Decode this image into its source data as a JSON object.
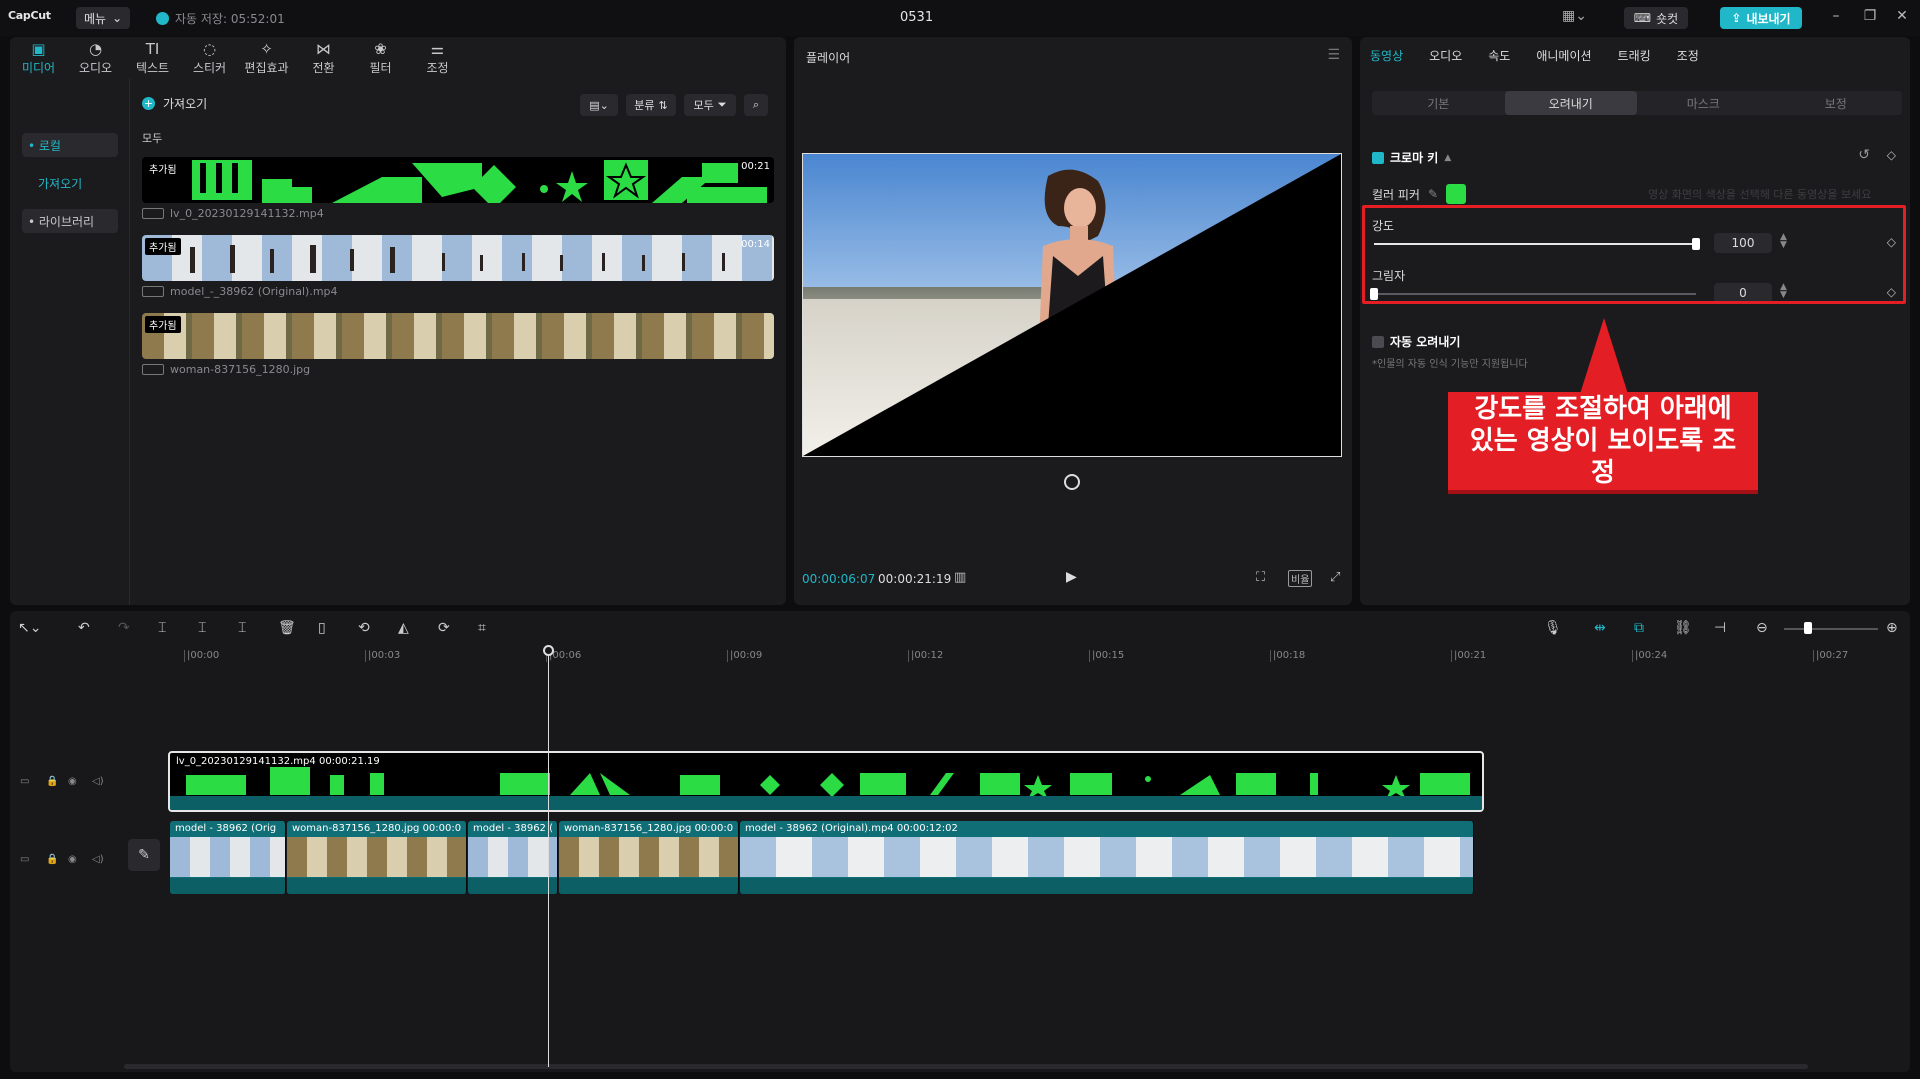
{
  "titlebar": {
    "logo": "CapCut",
    "menu_label": "메뉴",
    "autosave": "자동 저장: 05:52:01",
    "project_title": "0531",
    "shortcut_label": "숏컷",
    "export_label": "내보내기"
  },
  "media": {
    "tabs": [
      {
        "label": "미디어",
        "icon": "media-icon",
        "glyph": "▣"
      },
      {
        "label": "오디오",
        "icon": "audio-icon",
        "glyph": "◔"
      },
      {
        "label": "텍스트",
        "icon": "text-icon",
        "glyph": "TI"
      },
      {
        "label": "스티커",
        "icon": "sticker-icon",
        "glyph": "◌"
      },
      {
        "label": "편집효과",
        "icon": "effects-icon",
        "glyph": "✧"
      },
      {
        "label": "전환",
        "icon": "transition-icon",
        "glyph": "⋈"
      },
      {
        "label": "필터",
        "icon": "filter-icon",
        "glyph": "❀"
      },
      {
        "label": "조정",
        "icon": "adjust-icon",
        "glyph": "⚌"
      }
    ],
    "sidebar": {
      "local": "• 로컬",
      "import": "가져오기",
      "library": "• 라이브러리"
    },
    "import_button": "가져오기",
    "sort_label": "분류",
    "filter_label": "모두",
    "all_label": "모두",
    "clips": [
      {
        "badge": "추가됨",
        "duration": "00:21",
        "name": "lv_0_20230129141132.mp4"
      },
      {
        "badge": "추가됨",
        "duration": "00:14",
        "name": "model_-_38962 (Original).mp4"
      },
      {
        "badge": "추가됨",
        "duration": "",
        "name": "woman-837156_1280.jpg"
      }
    ]
  },
  "player": {
    "title": "플레이어",
    "current_time": "00:00:06:07",
    "total_time": "00:00:21:19",
    "ratio_label": "비율"
  },
  "properties": {
    "tabs": [
      "동영상",
      "오디오",
      "속도",
      "애니메이션",
      "트래킹",
      "조정"
    ],
    "active_tab": "동영상",
    "subtabs": [
      "기본",
      "오려내기",
      "마스크",
      "보정"
    ],
    "active_subtab": "오려내기",
    "chroma_key_label": "크로마 키",
    "color_picker_label": "컬러 피커",
    "picker_color": "#2bdc45",
    "faded_note": "영상 화면의 색상을 선택해 다른 동영상을 보세요",
    "intensity_label": "강도",
    "intensity_value": "100",
    "intensity_level": 100,
    "shadow_label": "그림자",
    "shadow_value": "0",
    "shadow_level": 0,
    "auto_cutout_label": "자동 오려내기",
    "auto_cutout_note": "*인물의 자동 인식 기능만 지원됩니다"
  },
  "callout": {
    "text": "강도를 조절하여 아래에 있는 영상이 보이도록 조정",
    "color": "#e31e24"
  },
  "timeline": {
    "ruler": [
      "|00:00",
      "|00:03",
      "|00:06",
      "|00:09",
      "|00:12",
      "|00:15",
      "|00:18",
      "|00:21",
      "|00:24",
      "|00:27"
    ],
    "main_clip": {
      "name": "lv_0_20230129141132.mp4",
      "duration": "00:00:21.19"
    },
    "sub_clips": [
      "model - 38962 (Orig",
      "woman-837156_1280.jpg  00:00:0",
      "model - 38962 (",
      "woman-837156_1280.jpg  00:00:0",
      "model - 38962 (Original).mp4   00:00:12:02"
    ]
  },
  "colors": {
    "accent": "#20b8c8",
    "chroma_green": "#2bdc45",
    "highlight": "#e31e24"
  }
}
